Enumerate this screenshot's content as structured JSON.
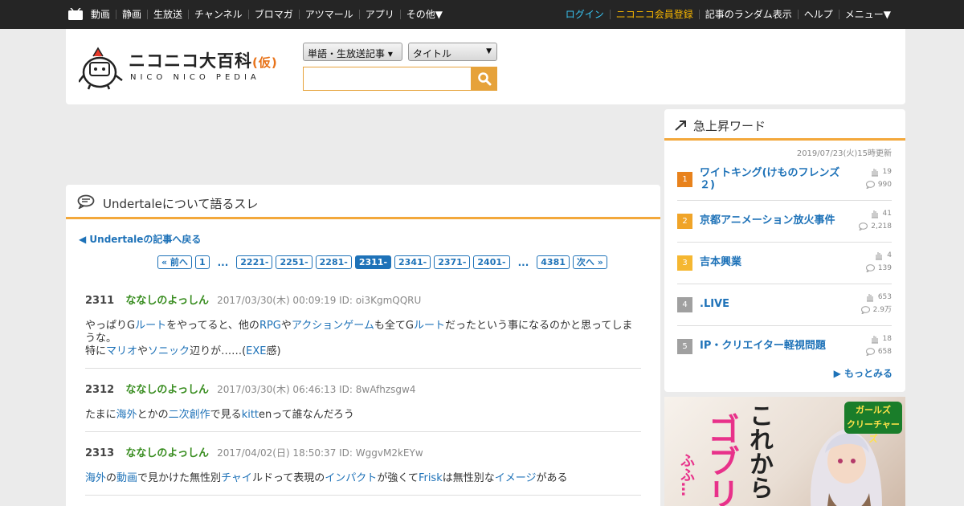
{
  "topbar": {
    "nav_left": [
      "動画",
      "静画",
      "生放送",
      "チャンネル",
      "ブロマガ",
      "アツマール",
      "アプリ",
      "その他▼"
    ],
    "login": "ログイン",
    "register": "ニコニコ会員登録",
    "nav_right": [
      "記事のランダム表示",
      "ヘルプ",
      "メニュー▼"
    ]
  },
  "header": {
    "logo_title": "ニコニコ大百科",
    "logo_tag": "(仮)",
    "logo_sub": "NICO NICO PEDIA",
    "select_type": "単語・生放送記事 ▾",
    "select_field": "タイトル",
    "select_field_arrow": "▼",
    "search_value": ""
  },
  "thread": {
    "title": "Undertaleについて語るスレ",
    "back_link": "◀ Undertaleの記事へ戻る",
    "pager": {
      "prev": "« 前へ",
      "first": "1",
      "dots1": "...",
      "pages": [
        "2221-",
        "2251-",
        "2281-",
        "2311-",
        "2341-",
        "2371-",
        "2401-"
      ],
      "current": "2311-",
      "dots2": "...",
      "last": "4381",
      "next": "次へ »"
    },
    "posts": [
      {
        "num": "2311",
        "name": "ななしのよっしん",
        "meta": "2017/03/30(木) 00:09:19 ID: oi3KgmQQRU",
        "parts": [
          [
            "t",
            "やっぱりG"
          ],
          [
            "l",
            "ルート"
          ],
          [
            "t",
            "をやってると、他の"
          ],
          [
            "l",
            "RPG"
          ],
          [
            "t",
            "や"
          ],
          [
            "l",
            "アクションゲーム"
          ],
          [
            "t",
            "も全てG"
          ],
          [
            "l",
            "ルート"
          ],
          [
            "t",
            "だったという事になるのかと思ってしまうな。"
          ],
          [
            "br",
            ""
          ],
          [
            "t",
            "特に"
          ],
          [
            "l",
            "マリオ"
          ],
          [
            "t",
            "や"
          ],
          [
            "l",
            "ソニック"
          ],
          [
            "t",
            "辺りが……("
          ],
          [
            "l",
            "EXE"
          ],
          [
            "t",
            "感)"
          ]
        ]
      },
      {
        "num": "2312",
        "name": "ななしのよっしん",
        "meta": "2017/03/30(木) 06:46:13 ID: 8wAfhzsgw4",
        "parts": [
          [
            "t",
            "たまに"
          ],
          [
            "l",
            "海外"
          ],
          [
            "t",
            "とかの"
          ],
          [
            "l",
            "二次創作"
          ],
          [
            "t",
            "で見る"
          ],
          [
            "l",
            "kitt"
          ],
          [
            "t",
            "enって誰なんだろう"
          ]
        ]
      },
      {
        "num": "2313",
        "name": "ななしのよっしん",
        "meta": "2017/04/02(日) 18:50:37 ID: WggvM2kEYw",
        "parts": [
          [
            "l",
            "海外"
          ],
          [
            "t",
            "の"
          ],
          [
            "l",
            "動画"
          ],
          [
            "t",
            "で見かけた無性別"
          ],
          [
            "l",
            "チャイ"
          ],
          [
            "t",
            "ルドって表現の"
          ],
          [
            "l",
            "インパクト"
          ],
          [
            "t",
            "が強くて"
          ],
          [
            "l",
            "Frisk"
          ],
          [
            "t",
            "は無性別な"
          ],
          [
            "l",
            "イメージ"
          ],
          [
            "t",
            "がある"
          ]
        ]
      }
    ]
  },
  "rising": {
    "title": "急上昇ワード",
    "updated": "2019/07/23(火)15時更新",
    "items": [
      {
        "rank": "1",
        "label": "ワイトキング(けものフレンズ２)",
        "a": "19",
        "b": "990",
        "color": "#e8821c"
      },
      {
        "rank": "2",
        "label": "京都アニメーション放火事件",
        "a": "41",
        "b": "2,218",
        "color": "#f0a428"
      },
      {
        "rank": "3",
        "label": "吉本興業",
        "a": "4",
        "b": "139",
        "color": "#f5b731"
      },
      {
        "rank": "4",
        "label": ".LIVE",
        "a": "653",
        "b": "2.9万",
        "color": "#a0a0a0"
      },
      {
        "rank": "5",
        "label": "IP・クリエイター軽視問題",
        "a": "18",
        "b": "658",
        "color": "#a0a0a0"
      }
    ],
    "more": "▶ もっとみる"
  },
  "ad": {
    "text1": "これから",
    "text2": "ゴブリ",
    "text3": "ふふ…",
    "logo_line1": "ガールズ",
    "logo_line2": "クリーチャーズ"
  }
}
